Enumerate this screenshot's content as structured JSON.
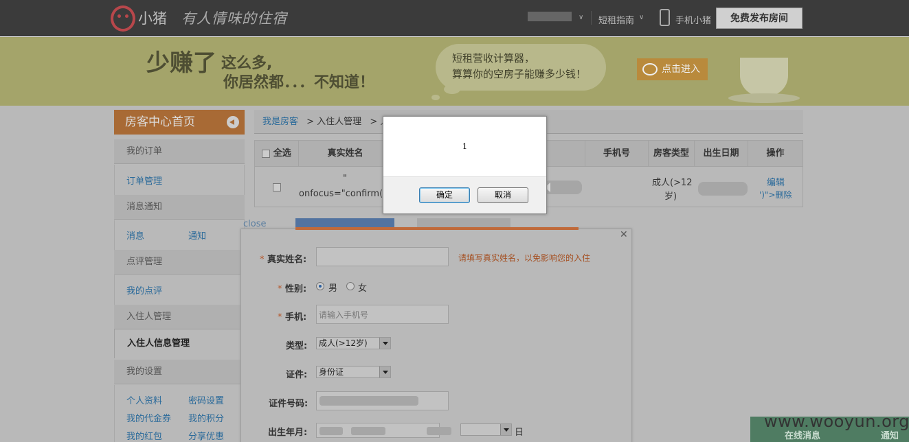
{
  "header": {
    "brand": "小猪",
    "slogan": "有人情味的住宿",
    "nav_guide": "短租指南",
    "nav_mobile": "手机小猪",
    "publish_button": "免费发布房间"
  },
  "banner": {
    "line1_big": "少赚了",
    "line1_small": "这么多,",
    "line2": "你居然都．．．不知道！",
    "bubble_line1": "短租营收计算器，",
    "bubble_line2": "算算你的空房子能赚多少钱！",
    "cta": "点击进入"
  },
  "sidebar": {
    "home": "房客中心首页",
    "groups": {
      "orders": "我的订单",
      "messages": "消息通知",
      "reviews": "点评管理",
      "guests": "入住人管理",
      "settings": "我的设置"
    },
    "links": {
      "order_manage": "订单管理",
      "message": "消息",
      "notice": "通知",
      "my_reviews": "我的点评",
      "guest_info": "入住人信息管理",
      "profile": "个人资料",
      "password": "密码设置",
      "coupons": "我的代金券",
      "points": "我的积分",
      "red_packet": "我的红包",
      "share": "分享优惠"
    }
  },
  "breadcrumb": {
    "root": "我是房客",
    "level2": "> 入住人管理",
    "level3": "> 入"
  },
  "table": {
    "select_all": "全选",
    "headers": [
      "真实姓名",
      "手机号",
      "房客类型",
      "出生日期",
      "操作"
    ],
    "row": {
      "name_line1": "\"",
      "name_line2": "onfocus=\"confirm(1",
      "guest_type_line1": "成人(>12",
      "guest_type_line2": "岁)",
      "edit": "编辑",
      "delete": "')\">删除"
    }
  },
  "form": {
    "close_text": "close",
    "name_label": "真实姓名:",
    "name_hint": "请填写真实姓名，以免影响您的入住",
    "gender_label": "性别:",
    "gender_male": "男",
    "gender_female": "女",
    "phone_label": "手机:",
    "phone_placeholder": "请输入手机号",
    "type_label": "类型:",
    "type_value": "成人(>12岁)",
    "id_label": "证件:",
    "id_value": "身份证",
    "id_number_label": "证件号码:",
    "birth_label": "出生年月:",
    "day_suffix": "日",
    "required_mark": "*"
  },
  "dialog": {
    "message": "1",
    "ok": "确定",
    "cancel": "取消"
  },
  "footer": {
    "online_messages": "在线消息",
    "notice": "通知",
    "watermark": "www.wooyun.org"
  }
}
